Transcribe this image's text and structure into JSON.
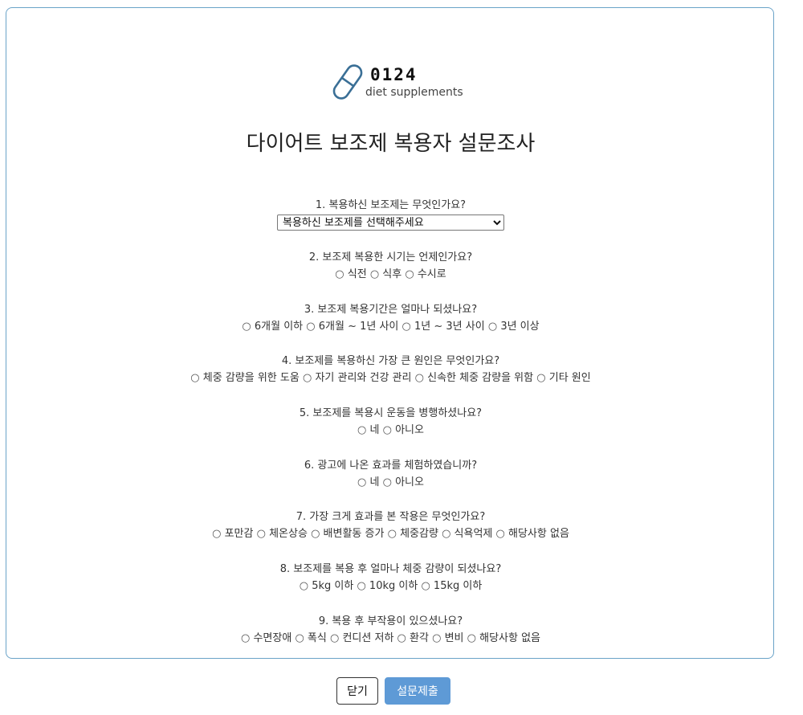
{
  "logo": {
    "number": "0124",
    "subtitle": "diet supplements",
    "icon": "capsule-icon"
  },
  "title": "다이어트 보조제 복용자 설문조사",
  "questions": [
    {
      "label": "1. 복용하신 보조제는 무엇인가요?",
      "select_placeholder": "복용하신 보조제를 선택해주세요"
    },
    {
      "label": "2. 보조제 복용한 시기는 언제인가요?",
      "options": [
        "식전",
        "식후",
        "수시로"
      ]
    },
    {
      "label": "3. 보조제 복용기간은 얼마나 되셨나요?",
      "options": [
        "6개월 이하",
        "6개월 ~ 1년 사이",
        "1년 ~ 3년 사이",
        "3년 이상"
      ]
    },
    {
      "label": "4. 보조제를 복용하신 가장 큰 원인은 무엇인가요?",
      "options": [
        "체중 감량을 위한 도움",
        "자기 관리와 건강 관리",
        "신속한 체중 감량을 위함",
        "기타 원인"
      ]
    },
    {
      "label": "5. 보조제를 복용시 운동을 병행하셨나요?",
      "options": [
        "네",
        "아니오"
      ]
    },
    {
      "label": "6. 광고에 나온 효과를 체험하였습니까?",
      "options": [
        "네",
        "아니오"
      ]
    },
    {
      "label": "7. 가장 크게 효과를 본 작용은 무엇인가요?",
      "options": [
        "포만감",
        "체온상승",
        "배변활동 증가",
        "체중감량",
        "식욕억제",
        "해당사항 없음"
      ]
    },
    {
      "label": "8. 보조제를 복용 후 얼마나 체중 감량이 되셨나요?",
      "options": [
        "5kg 이하",
        "10kg 이하",
        "15kg 이하"
      ]
    },
    {
      "label": "9. 복용 후 부작용이 있으셨나요?",
      "options": [
        "수면장애",
        "폭식",
        "컨디션 저하",
        "환각",
        "변비",
        "해당사항 없음"
      ]
    }
  ],
  "radio_symbol": "○",
  "buttons": {
    "close": "닫기",
    "submit": "설문제출"
  },
  "colors": {
    "border": "#6aa3c8",
    "submit_bg": "#5e9ad6",
    "capsule_stroke": "#3a6f96"
  }
}
